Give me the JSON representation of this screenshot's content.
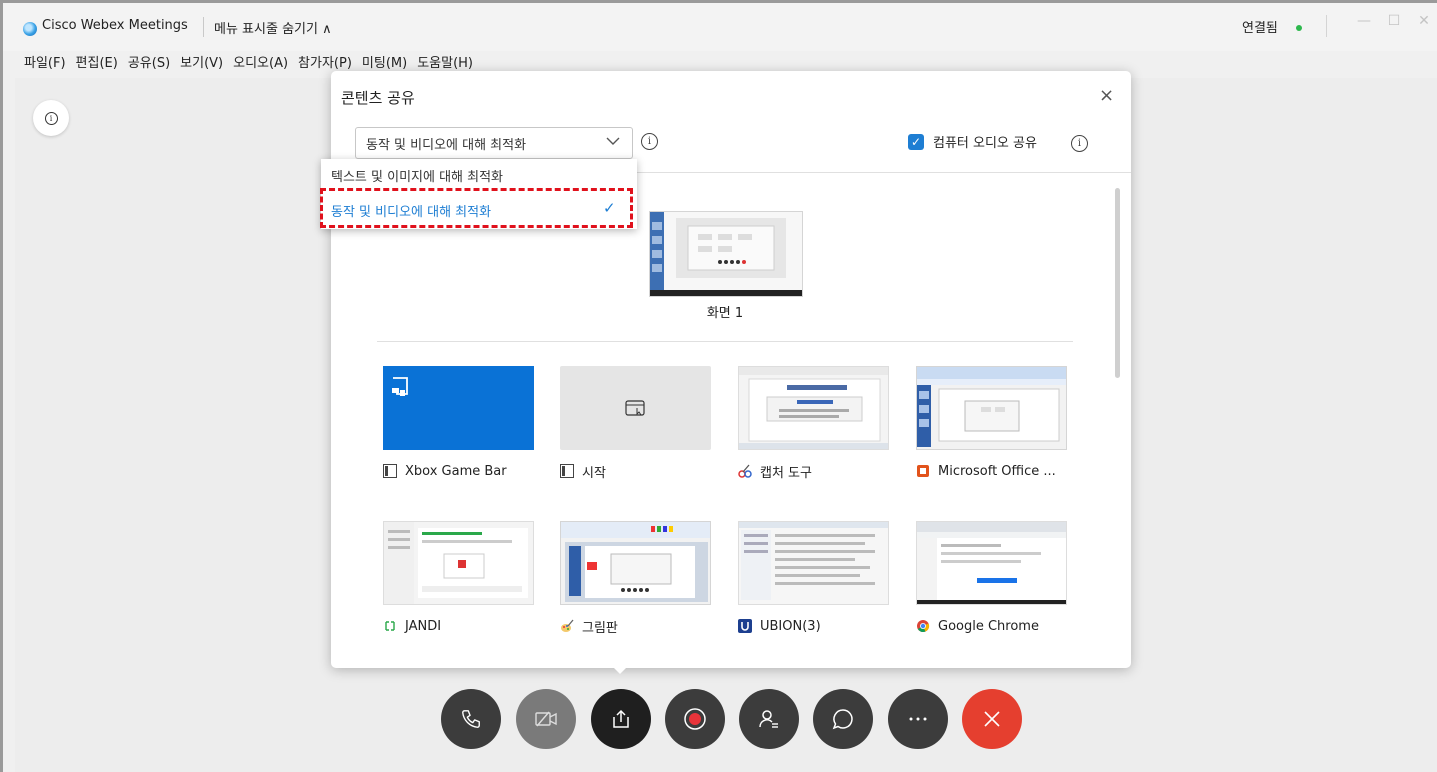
{
  "titlebar": {
    "app_title": "Cisco Webex Meetings",
    "menu_toggle": "메뉴 표시줄 숨기기 ∧",
    "status": "연결됨",
    "status_color": "#2db84d",
    "minimize": "—",
    "maximize": "☐",
    "close": "✕"
  },
  "menubar": {
    "items": [
      "파일(F)",
      "편집(E)",
      "공유(S)",
      "보기(V)",
      "오디오(A)",
      "참가자(P)",
      "미팅(M)",
      "도움말(H)"
    ]
  },
  "dialog": {
    "title": "콘텐츠 공유",
    "close": "×",
    "optimize_selected": "동작 및 비디오에 대해 최적화",
    "optimize_options": [
      "텍스트 및 이미지에 대해 최적화",
      "동작 및 비디오에 대해 최적화"
    ],
    "share_audio_label": "컴퓨터 오디오 공유",
    "share_audio_checked": true,
    "info_symbol": "i",
    "screen_label": "화면 1",
    "apps": [
      {
        "label": "Xbox Game Bar",
        "icon": "window-icon"
      },
      {
        "label": "시작",
        "icon": "window-icon"
      },
      {
        "label": "캡처 도구",
        "icon": "snipping-tool-icon"
      },
      {
        "label": "Microsoft Office ...",
        "icon": "office-icon"
      },
      {
        "label": "JANDI",
        "icon": "jandi-icon"
      },
      {
        "label": "그림판",
        "icon": "paint-icon"
      },
      {
        "label": "UBION(3)",
        "icon": "ubion-icon"
      },
      {
        "label": "Google Chrome",
        "icon": "chrome-icon"
      }
    ]
  },
  "controls": [
    "phone-icon",
    "video-off-icon",
    "share-icon",
    "record-icon",
    "participants-icon",
    "chat-icon",
    "more-icon",
    "leave-icon"
  ],
  "colors": {
    "accent": "#1e7ed3",
    "leave_red": "#e53f2f",
    "control_gray": "#3c3c3c",
    "highlight_red": "#e0111c"
  }
}
